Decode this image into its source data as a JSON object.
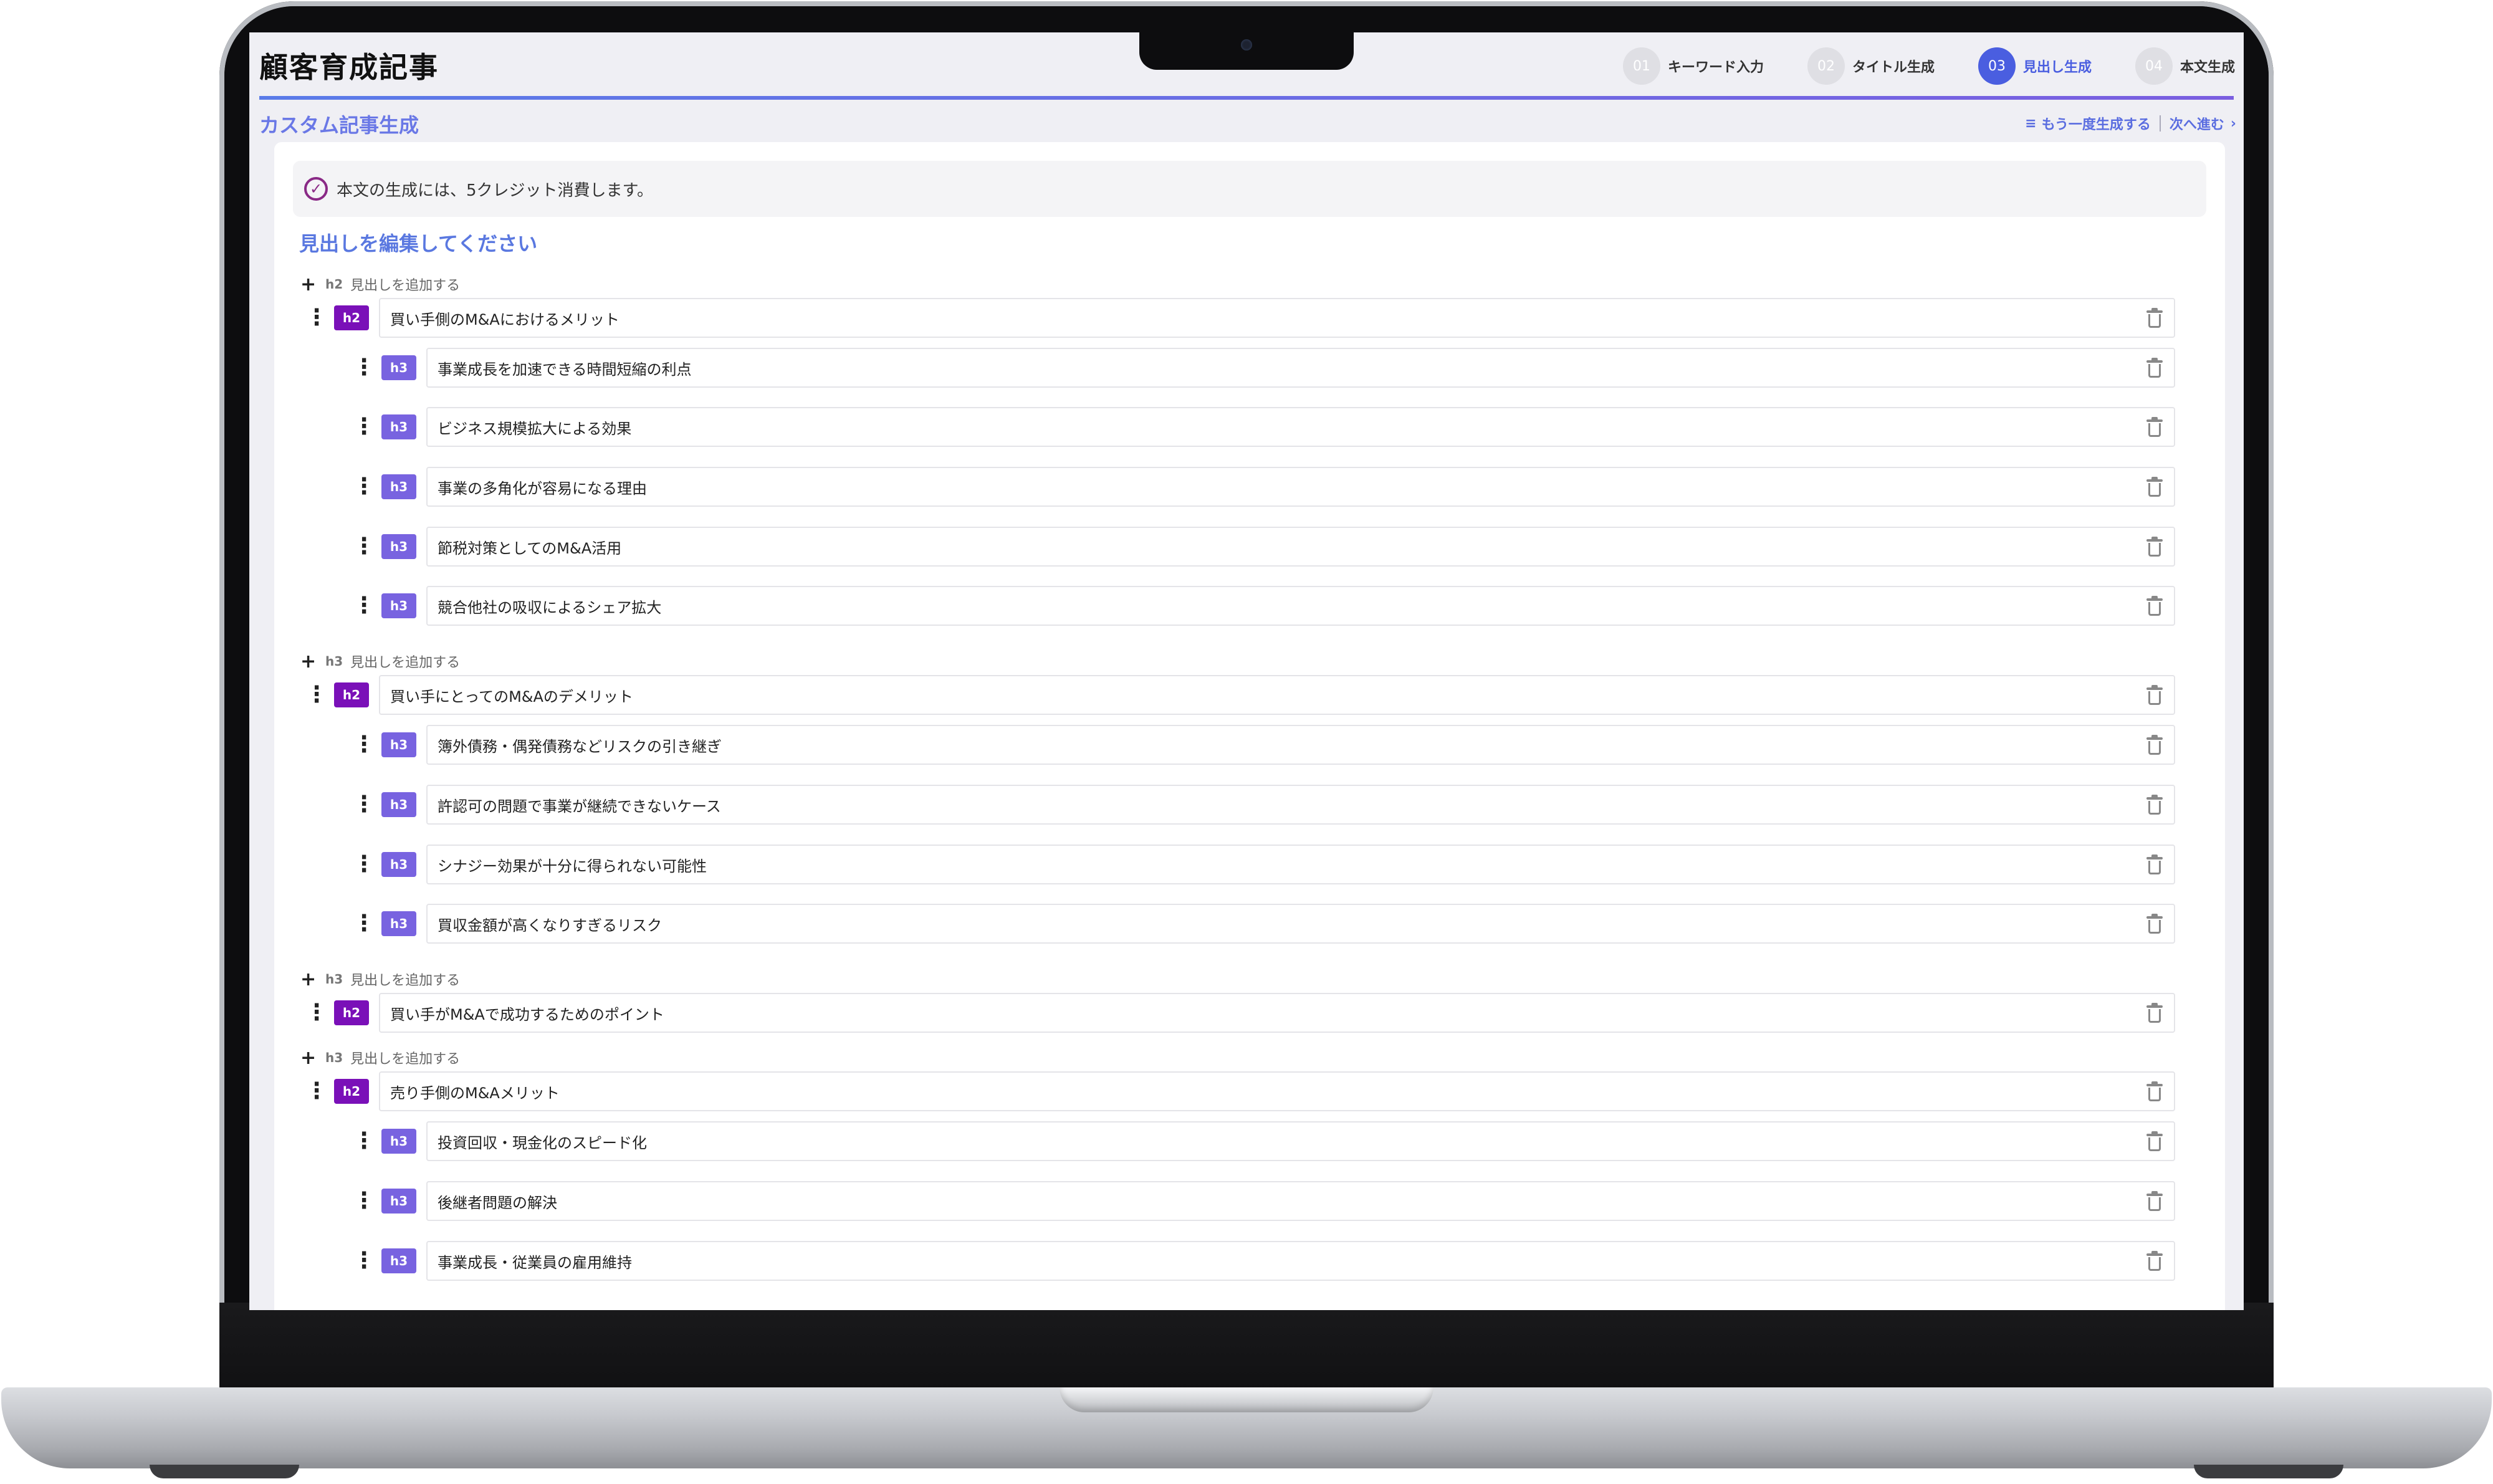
{
  "app": {
    "title": "顧客育成記事"
  },
  "steps": [
    {
      "num": "01",
      "label": "キーワード入力"
    },
    {
      "num": "02",
      "label": "タイトル生成"
    },
    {
      "num": "03",
      "label": "見出し生成"
    },
    {
      "num": "04",
      "label": "本文生成"
    }
  ],
  "subheader": {
    "title": "カスタム記事生成",
    "regenerate_label": "もう一度生成する",
    "next_label": "次へ進む"
  },
  "notice": {
    "text": "本文の生成には、5クレジット消費します。"
  },
  "editor": {
    "section_title": "見出しを編集してください",
    "add_label": "見出しを追加する",
    "add_h2_level": "h2",
    "add_h3_level": "h3",
    "tag_h2": "h2",
    "tag_h3": "h3"
  },
  "headings": [
    {
      "level": "h2",
      "text": "買い手側のM&Aにおけるメリット"
    },
    {
      "level": "h3",
      "text": "事業成長を加速できる時間短縮の利点"
    },
    {
      "level": "h3",
      "text": "ビジネス規模拡大による効果"
    },
    {
      "level": "h3",
      "text": "事業の多角化が容易になる理由"
    },
    {
      "level": "h3",
      "text": "節税対策としてのM&A活用"
    },
    {
      "level": "h3",
      "text": "競合他社の吸収によるシェア拡大"
    },
    {
      "level": "h2",
      "text": "買い手にとってのM&Aのデメリット"
    },
    {
      "level": "h3",
      "text": "簿外債務・偶発債務などリスクの引き継ぎ"
    },
    {
      "level": "h3",
      "text": "許認可の問題で事業が継続できないケース"
    },
    {
      "level": "h3",
      "text": "シナジー効果が十分に得られない可能性"
    },
    {
      "level": "h3",
      "text": "買収金額が高くなりすぎるリスク"
    },
    {
      "level": "h2",
      "text": "買い手がM&Aで成功するためのポイント"
    },
    {
      "level": "h2",
      "text": "売り手側のM&Aメリット"
    },
    {
      "level": "h3",
      "text": "投資回収・現金化のスピード化"
    },
    {
      "level": "h3",
      "text": "後継者問題の解決"
    },
    {
      "level": "h3",
      "text": "事業成長・従業員の雇用維持"
    }
  ],
  "colors": {
    "accent": "#4a5ee0",
    "h2_tag": "#7a10b8",
    "h3_tag": "#7863e0",
    "check": "#8a2a86"
  },
  "icons": {
    "drag": "drag-handle-icon",
    "trash": "trash-icon",
    "plus": "plus-icon",
    "check": "check-circle-icon",
    "regenerate": "regenerate-icon",
    "next": "chevron-right-icon"
  }
}
